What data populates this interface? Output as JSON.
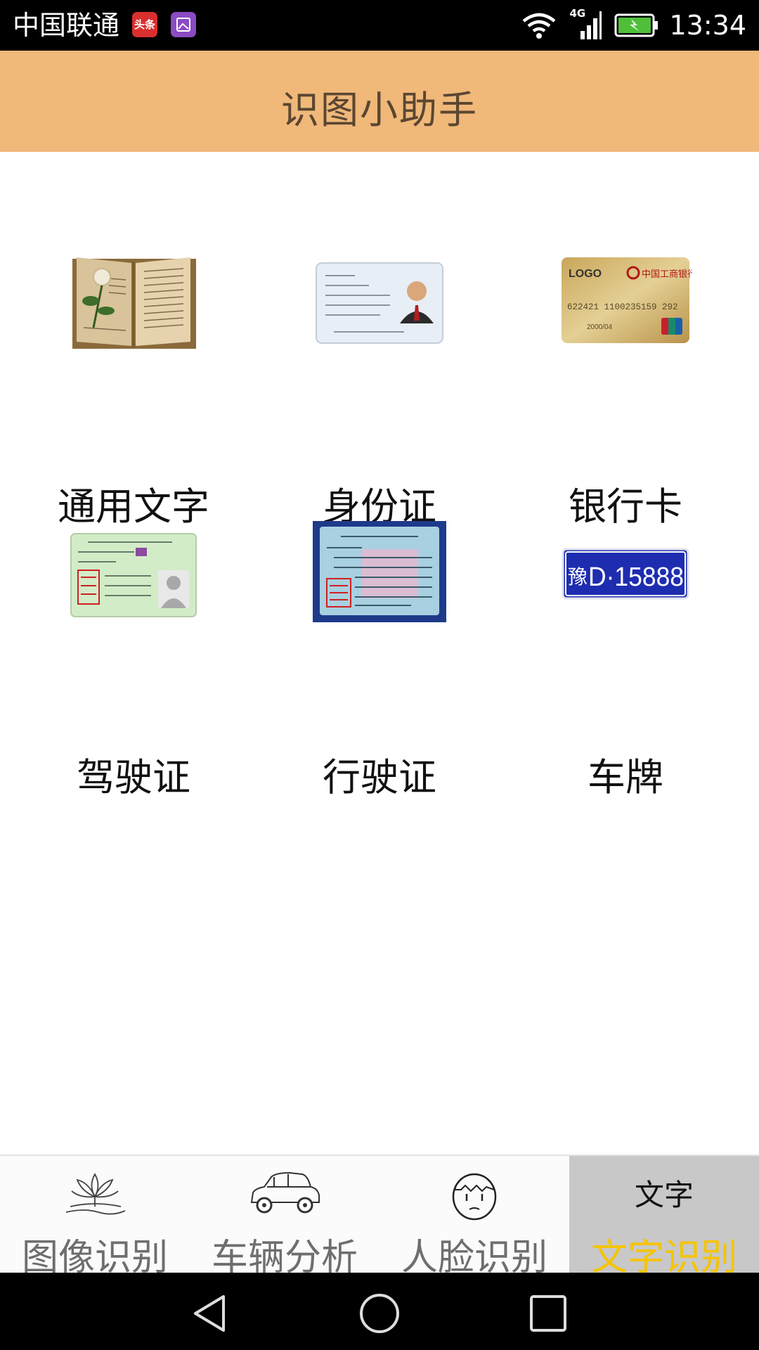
{
  "status_bar": {
    "carrier": "中国联通",
    "news_badge": "头条",
    "network": "4G",
    "time": "13:34"
  },
  "header": {
    "title": "识图小助手"
  },
  "grid": {
    "items": [
      {
        "label": "通用文字",
        "icon": "open-book-icon"
      },
      {
        "label": "身份证",
        "icon": "id-card-icon"
      },
      {
        "label": "银行卡",
        "icon": "bank-card-icon"
      },
      {
        "label": "驾驶证",
        "icon": "driver-license-icon"
      },
      {
        "label": "行驶证",
        "icon": "vehicle-license-icon"
      },
      {
        "label": "车牌",
        "icon": "license-plate-icon"
      }
    ],
    "bank_card": {
      "logo": "LOGO",
      "number": "622421 1100235159 292",
      "expiry": "2000/04",
      "bank": "中国工商银行"
    },
    "license_plate": {
      "province": "豫",
      "number": "D·15888"
    }
  },
  "tabs": {
    "items": [
      {
        "label": "图像识别",
        "icon": "lotus-icon",
        "active": false
      },
      {
        "label": "车辆分析",
        "icon": "car-icon",
        "active": false
      },
      {
        "label": "人脸识别",
        "icon": "face-icon",
        "active": false
      },
      {
        "label": "文字识别",
        "icon": "text-icon",
        "active": true
      }
    ],
    "active_icon_text": "文字"
  },
  "colors": {
    "header_bg": "#f0b879",
    "active_tab_bg": "#c8c8c8",
    "active_tab_text": "#f5c400"
  }
}
